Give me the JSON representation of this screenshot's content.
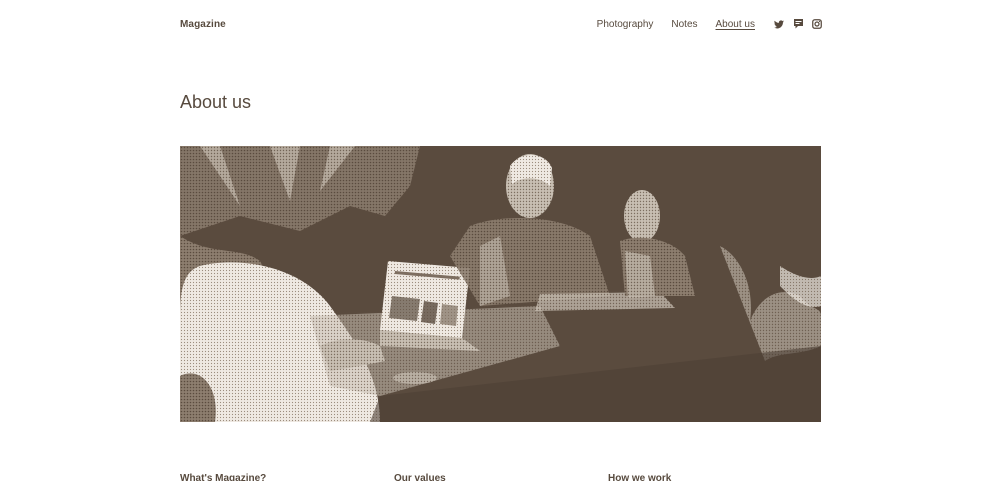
{
  "header": {
    "brand": "Magazine",
    "nav": [
      {
        "label": "Photography"
      },
      {
        "label": "Notes"
      },
      {
        "label": "About us",
        "active": true
      }
    ],
    "social_icons": [
      "twitter-icon",
      "chat-icon",
      "instagram-icon"
    ]
  },
  "page": {
    "title": "About us"
  },
  "sections": [
    {
      "heading": "What's Magazine?"
    },
    {
      "heading": "Our values"
    },
    {
      "heading": "How we work"
    }
  ],
  "colors": {
    "text": "#574a3e",
    "hero_bg": "#5a4b3e",
    "background": "#ffffff"
  }
}
